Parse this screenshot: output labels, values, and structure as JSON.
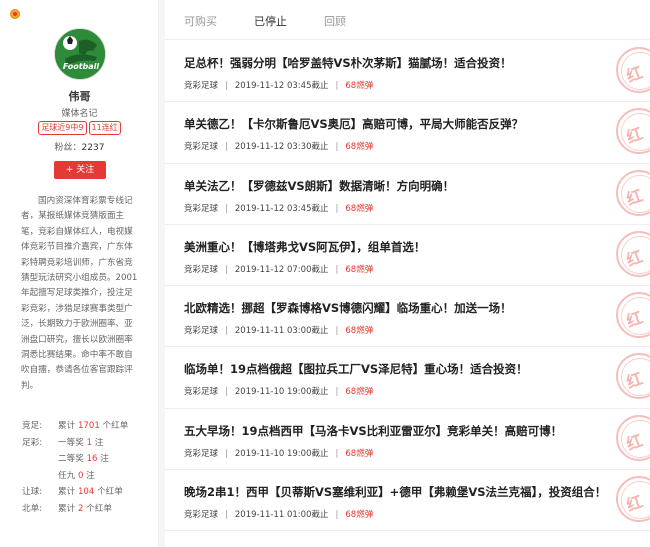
{
  "profile": {
    "name": "伟哥",
    "title": "媒体名记",
    "badges": [
      "足球近9中9",
      "11连红"
    ],
    "fans_label": "粉丝：",
    "fans_count": "2237",
    "follow_label": "+ 关注",
    "avatar_text": "Football",
    "bio": "国内资深体育彩票专线记者，某报纸媒体竞猜版面主笔，竞彩自媒体红人，电视媒体竞彩节目推介嘉宾，广东体彩特聘竞彩培训师，广东省竞猜型玩法研究小组成员。2001年起擅写足球类推介，投注足彩竞彩，涉猎足球赛事类型广泛，长期致力于欧洲圈率、亚洲盘口研究，擅长以欧洲圈率洞悉比赛结果。命中率不敢自吹自擂，恭请各位客官跟踪评判。"
  },
  "stats": [
    {
      "label": "竞足:",
      "prefix": "累计",
      "num": "1701",
      "suffix": "个红单"
    },
    {
      "label": "足彩:",
      "prefix": "一等奖",
      "num": "1",
      "suffix": "注"
    },
    {
      "label": "",
      "prefix": "二等奖",
      "num": "16",
      "suffix": "注"
    },
    {
      "label": "",
      "prefix": "任九",
      "num": "0",
      "suffix": "注"
    },
    {
      "label": "让球:",
      "prefix": "累计",
      "num": "104",
      "suffix": "个红单"
    },
    {
      "label": "北单:",
      "prefix": "累计",
      "num": "2",
      "suffix": "个红单"
    }
  ],
  "tabs": [
    "可购买",
    "已停止",
    "回顾"
  ],
  "active_tab": "已停止",
  "stamp_text": "红",
  "articles": [
    {
      "title": "足总杯！强弱分明【哈罗盖特VS朴次茅斯】猫腻场！适合投资！",
      "category": "竞彩足球",
      "time": "2019-11-12 03:45截止",
      "price": "68燃弹"
    },
    {
      "title": "单关德乙！【卡尔斯鲁厄VS奥厄】高赔可博，平局大师能否反弹？",
      "category": "竞彩足球",
      "time": "2019-11-12 03:30截止",
      "price": "68燃弹"
    },
    {
      "title": "单关法乙！【罗德兹VS朗斯】数据清晰！方向明确！",
      "category": "竞彩足球",
      "time": "2019-11-12 03:45截止",
      "price": "68燃弹"
    },
    {
      "title": "美洲重心！【博塔弗戈VS阿瓦伊】，组单首选！",
      "category": "竞彩足球",
      "time": "2019-11-12 07:00截止",
      "price": "68燃弹"
    },
    {
      "title": "北欧精选！挪超【罗森博格VS博德闪耀】临场重心！加送一场！",
      "category": "竞彩足球",
      "time": "2019-11-11 03:00截止",
      "price": "68燃弹"
    },
    {
      "title": "临场单！19点档俄超【图拉兵工厂VS泽尼特】重心场！适合投资！",
      "category": "竞彩足球",
      "time": "2019-11-10 19:00截止",
      "price": "68燃弹"
    },
    {
      "title": "五大早场！19点档西甲【马洛卡VS比利亚雷亚尔】竞彩单关！高赔可博！",
      "category": "竞彩足球",
      "time": "2019-11-10 19:00截止",
      "price": "68燃弹"
    },
    {
      "title": "晚场2串1！西甲【贝蒂斯VS塞维利亚】+德甲【弗赖堡VS法兰克福】，投资组合！",
      "category": "竞彩足球",
      "time": "2019-11-11 01:00截止",
      "price": "68燃弹"
    }
  ],
  "colors": {
    "accent": "#e53935",
    "avatar_bg": "#2e8b3a"
  }
}
